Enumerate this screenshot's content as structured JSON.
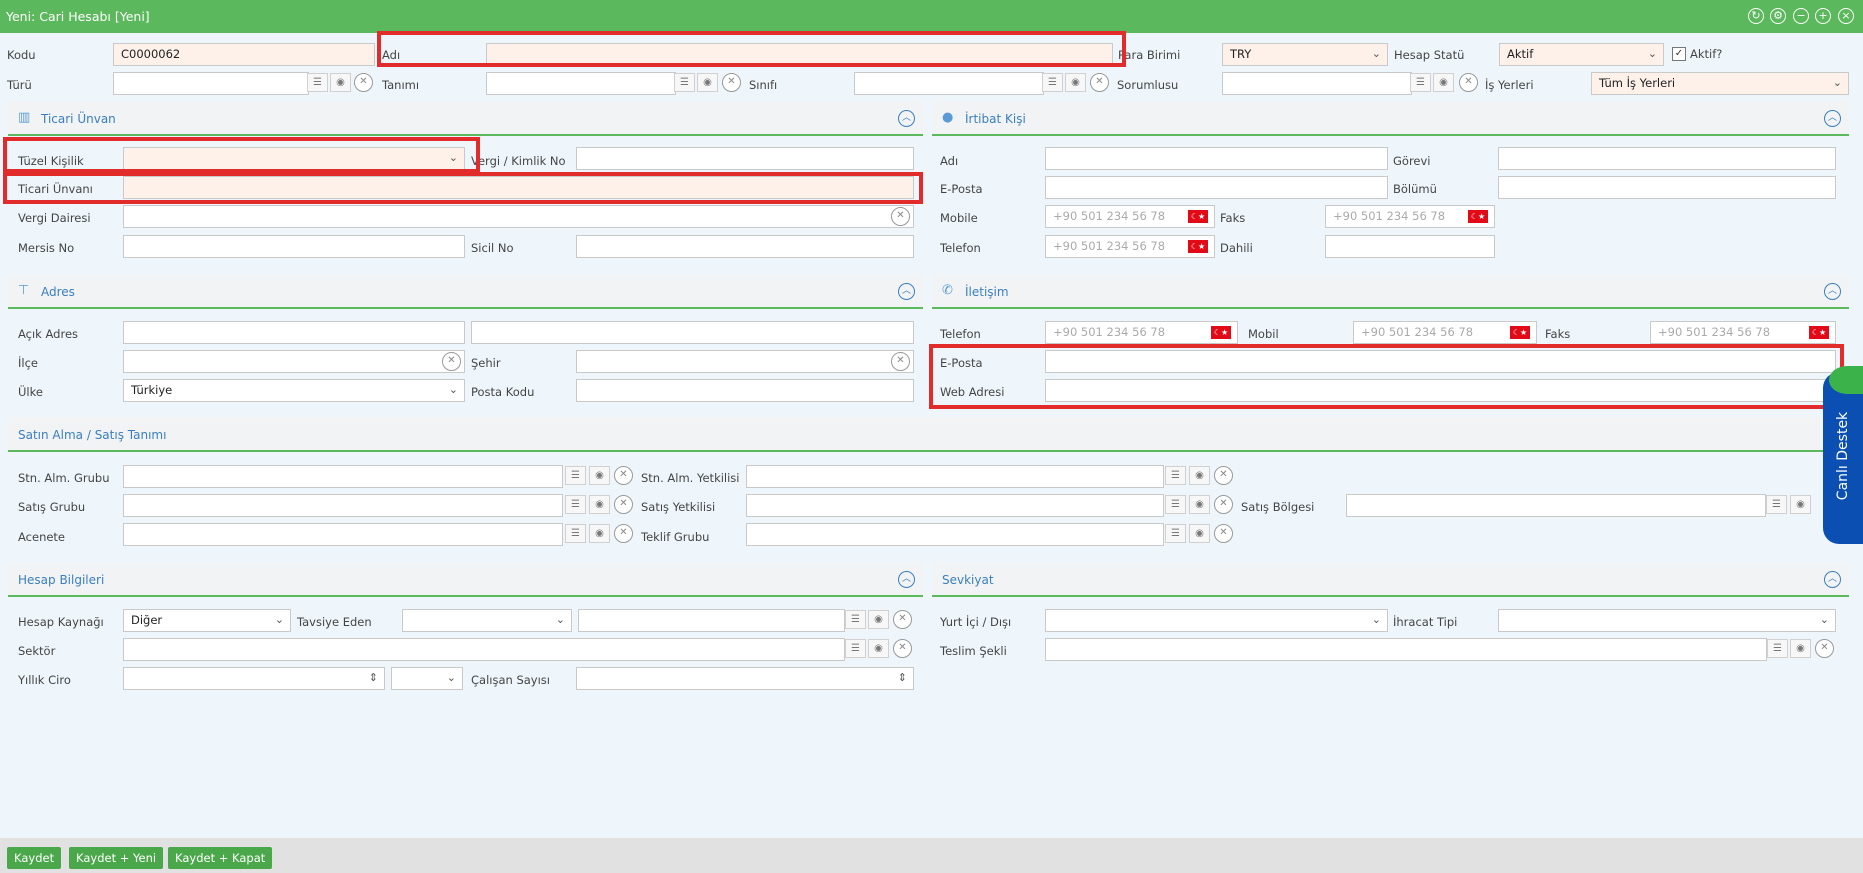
{
  "window": {
    "title": "Yeni: Cari Hesabı [Yeni]"
  },
  "top": {
    "kodu_label": "Kodu",
    "kodu_value": "C0000062",
    "adi_label": "Adı",
    "para_birimi_label": "Para Birimi",
    "para_birimi_value": "TRY",
    "hesap_statu_label": "Hesap Statü",
    "hesap_statu_value": "Aktif",
    "aktif_label": "Aktif?",
    "turu_label": "Türü",
    "tanimi_label": "Tanımı",
    "sinifi_label": "Sınıfı",
    "sorumlusu_label": "Sorumlusu",
    "is_yerleri_label": "İş Yerleri",
    "is_yerleri_value": "Tüm İş Yerleri"
  },
  "ticari": {
    "title": "Ticari Ünvan",
    "tuzel_label": "Tüzel Kişilik",
    "vergi_kimlik_label": "Vergi / Kimlik No",
    "ticari_unvani_label": "Ticari Ünvanı",
    "vergi_dairesi_label": "Vergi Dairesi",
    "mersis_label": "Mersis No",
    "sicil_label": "Sicil No"
  },
  "irtibat": {
    "title": "İrtibat Kişi",
    "adi_label": "Adı",
    "gorevi_label": "Görevi",
    "eposta_label": "E-Posta",
    "bolumu_label": "Bölümü",
    "mobile_label": "Mobile",
    "faks_label": "Faks",
    "telefon_label": "Telefon",
    "dahili_label": "Dahili",
    "phone_placeholder": "+90 501 234 56 78"
  },
  "adres": {
    "title": "Adres",
    "acik_label": "Açık Adres",
    "ilce_label": "İlçe",
    "sehir_label": "Şehir",
    "ulke_label": "Ülke",
    "ulke_value": "Türkiye",
    "posta_label": "Posta Kodu"
  },
  "iletisim": {
    "title": "İletişim",
    "telefon_label": "Telefon",
    "mobil_label": "Mobil",
    "faks_label": "Faks",
    "eposta_label": "E-Posta",
    "web_label": "Web Adresi",
    "phone_placeholder": "+90 501 234 56 78"
  },
  "satin": {
    "title": "Satın Alma / Satış Tanımı",
    "stn_grubu_label": "Stn. Alm. Grubu",
    "stn_yetkili_label": "Stn. Alm. Yetkilisi",
    "satis_grubu_label": "Satış Grubu",
    "satis_yetkili_label": "Satış Yetkilisi",
    "satis_bolgesi_label": "Satış Bölgesi",
    "acente_label": "Acenete",
    "teklif_label": "Teklif Grubu"
  },
  "hesap": {
    "title": "Hesap Bilgileri",
    "kaynak_label": "Hesap Kaynağı",
    "kaynak_value": "Diğer",
    "tavsiye_label": "Tavsiye Eden",
    "sektor_label": "Sektör",
    "ciro_label": "Yıllık Ciro",
    "calisan_label": "Çalışan Sayısı"
  },
  "sevkiyat": {
    "title": "Sevkiyat",
    "yurt_label": "Yurt İçi / Dışı",
    "ihracat_label": "İhracat Tipi",
    "teslim_label": "Teslim Şekli"
  },
  "footer": {
    "kaydet": "Kaydet",
    "kaydet_yeni": "Kaydet + Yeni",
    "kaydet_kapat": "Kaydet + Kapat"
  },
  "support": {
    "label": "Canlı Destek"
  },
  "colors": {
    "accent_green": "#5cb85c",
    "link_blue": "#3a7fc0",
    "highlight_red": "#e22b2b",
    "flag_red": "#e30a17"
  }
}
